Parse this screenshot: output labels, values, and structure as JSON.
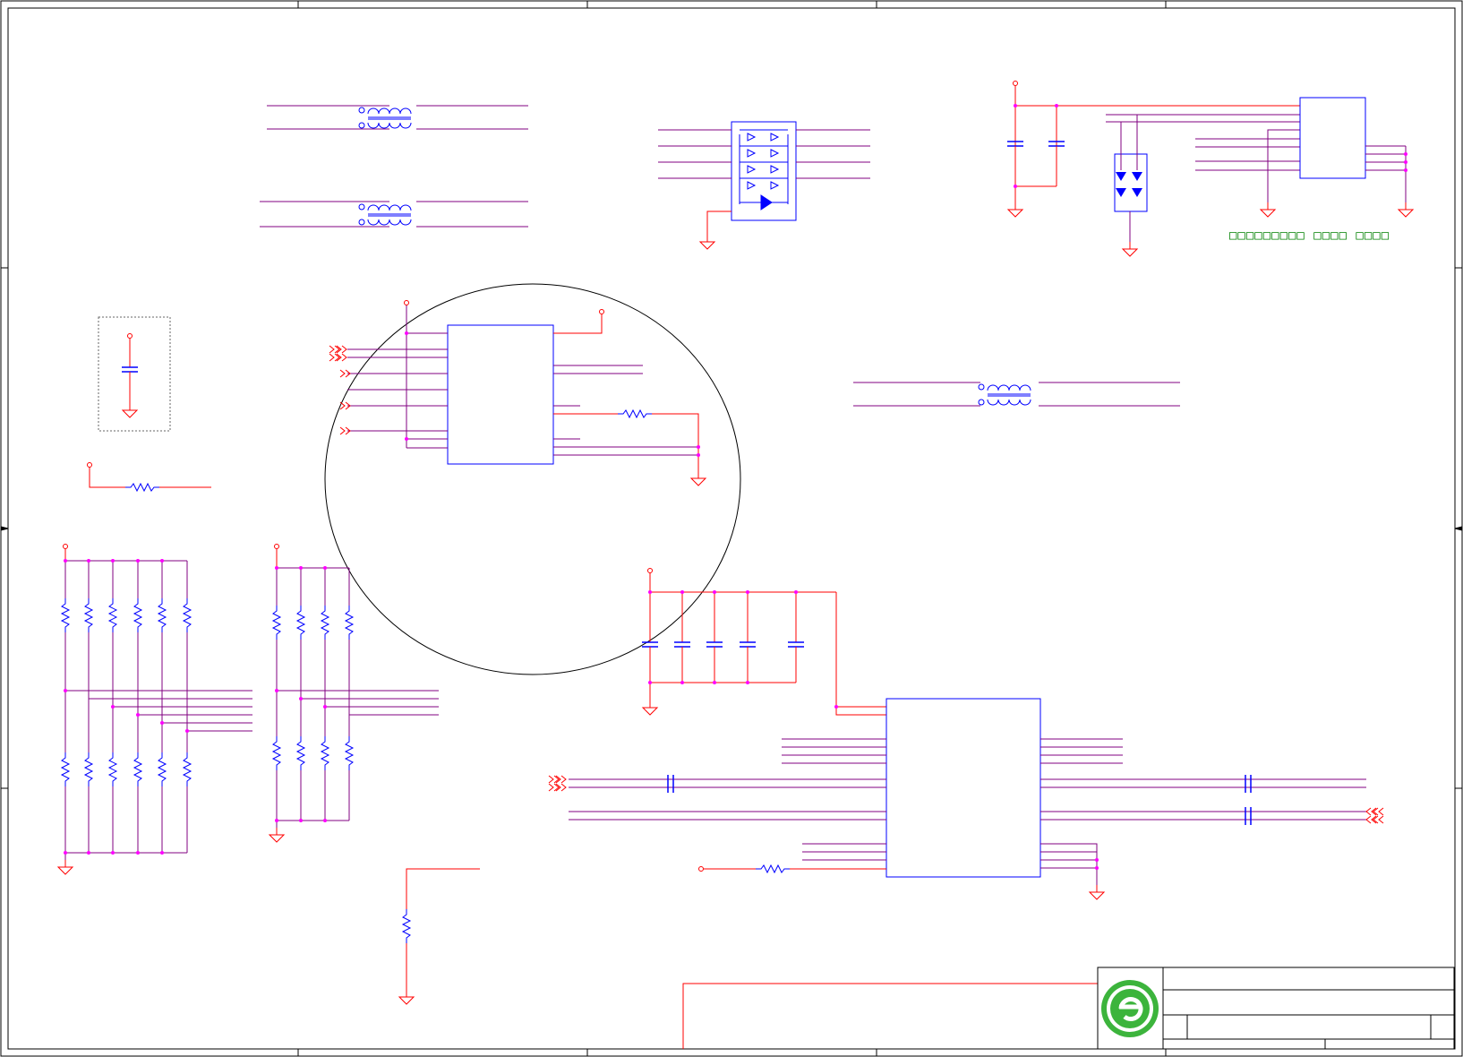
{
  "schematic": {
    "note_text": "□□□□□□□□□ □□□□ □□□□",
    "colors": {
      "wire": "#ff0000",
      "bus": "#800080",
      "component": "#0000ff",
      "junction": "#ff00ff",
      "frame": "#000000",
      "note": "#008000",
      "logo": "#3cb43c"
    },
    "icons": [
      "company-logo",
      "ground-symbol",
      "power-port",
      "transformer",
      "diode-array",
      "resistor",
      "capacitor"
    ]
  }
}
